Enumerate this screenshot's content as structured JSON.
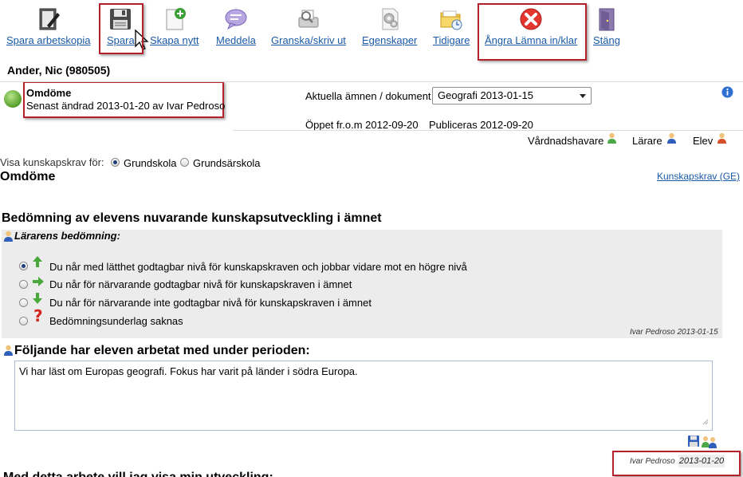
{
  "toolbar": {
    "items": [
      {
        "label": "Spara arbetskopia",
        "icon": "clipboard-pen-icon"
      },
      {
        "label": "Spara",
        "icon": "floppy-disk-icon"
      },
      {
        "label": "Skapa nytt",
        "icon": "new-document-icon"
      },
      {
        "label": "Meddela",
        "icon": "speech-bubble-icon"
      },
      {
        "label": "Granska/skriv ut",
        "icon": "print-preview-icon"
      },
      {
        "label": "Egenskaper",
        "icon": "gears-icon"
      },
      {
        "label": "Tidigare",
        "icon": "folder-clock-icon"
      },
      {
        "label": "Ångra Lämna in/klar",
        "icon": "red-x-icon"
      },
      {
        "label": "Stäng",
        "icon": "door-exit-icon"
      }
    ]
  },
  "student": {
    "name": "Ander, Nic (980505)"
  },
  "document": {
    "title": "Omdöme",
    "last_changed": "Senast ändrad 2013-01-20 av Ivar Pedroso",
    "status_color": "#6cb33f"
  },
  "subject": {
    "label": "Aktuella ämnen / dokument",
    "selected": "Geografi 2013-01-15",
    "open_from": "Öppet fr.o.m 2012-09-20",
    "published": "Publiceras 2012-09-20"
  },
  "roles": [
    "Vårdnadshavare",
    "Lärare",
    "Elev"
  ],
  "show_for": {
    "label": "Visa kunskapskrav för:",
    "options": [
      "Grundskola",
      "Grundsärskola"
    ],
    "selected": "Grundskola"
  },
  "section": {
    "title": "Omdöme",
    "link": "Kunskapskrav (GE)"
  },
  "assessment": {
    "heading": "Bedömning av elevens nuvarande kunskapsutveckling i ämnet",
    "teacher_label": "Lärarens bedömning:",
    "options": [
      "Du når med lätthet godtagbar nivå för kunskapskraven och jobbar vidare mot en högre nivå",
      "Du når för närvarande godtagbar nivå för kunskapskraven i ämnet",
      "Du når för närvarande inte godtagbar nivå för kunskapskraven i ämnet",
      "Bedömningsunderlag saknas"
    ],
    "signature": "Ivar Pedroso 2013-01-15"
  },
  "work": {
    "heading": "Följande har eleven arbetat med under perioden:",
    "text": "Vi har läst om Europas geografi. Fokus har varit på länder i södra Europa.",
    "sig_name": "Ivar Pedroso",
    "sig_date": "2013-01-20"
  },
  "next_heading": "Med detta arbete vill jag visa min utveckling:"
}
